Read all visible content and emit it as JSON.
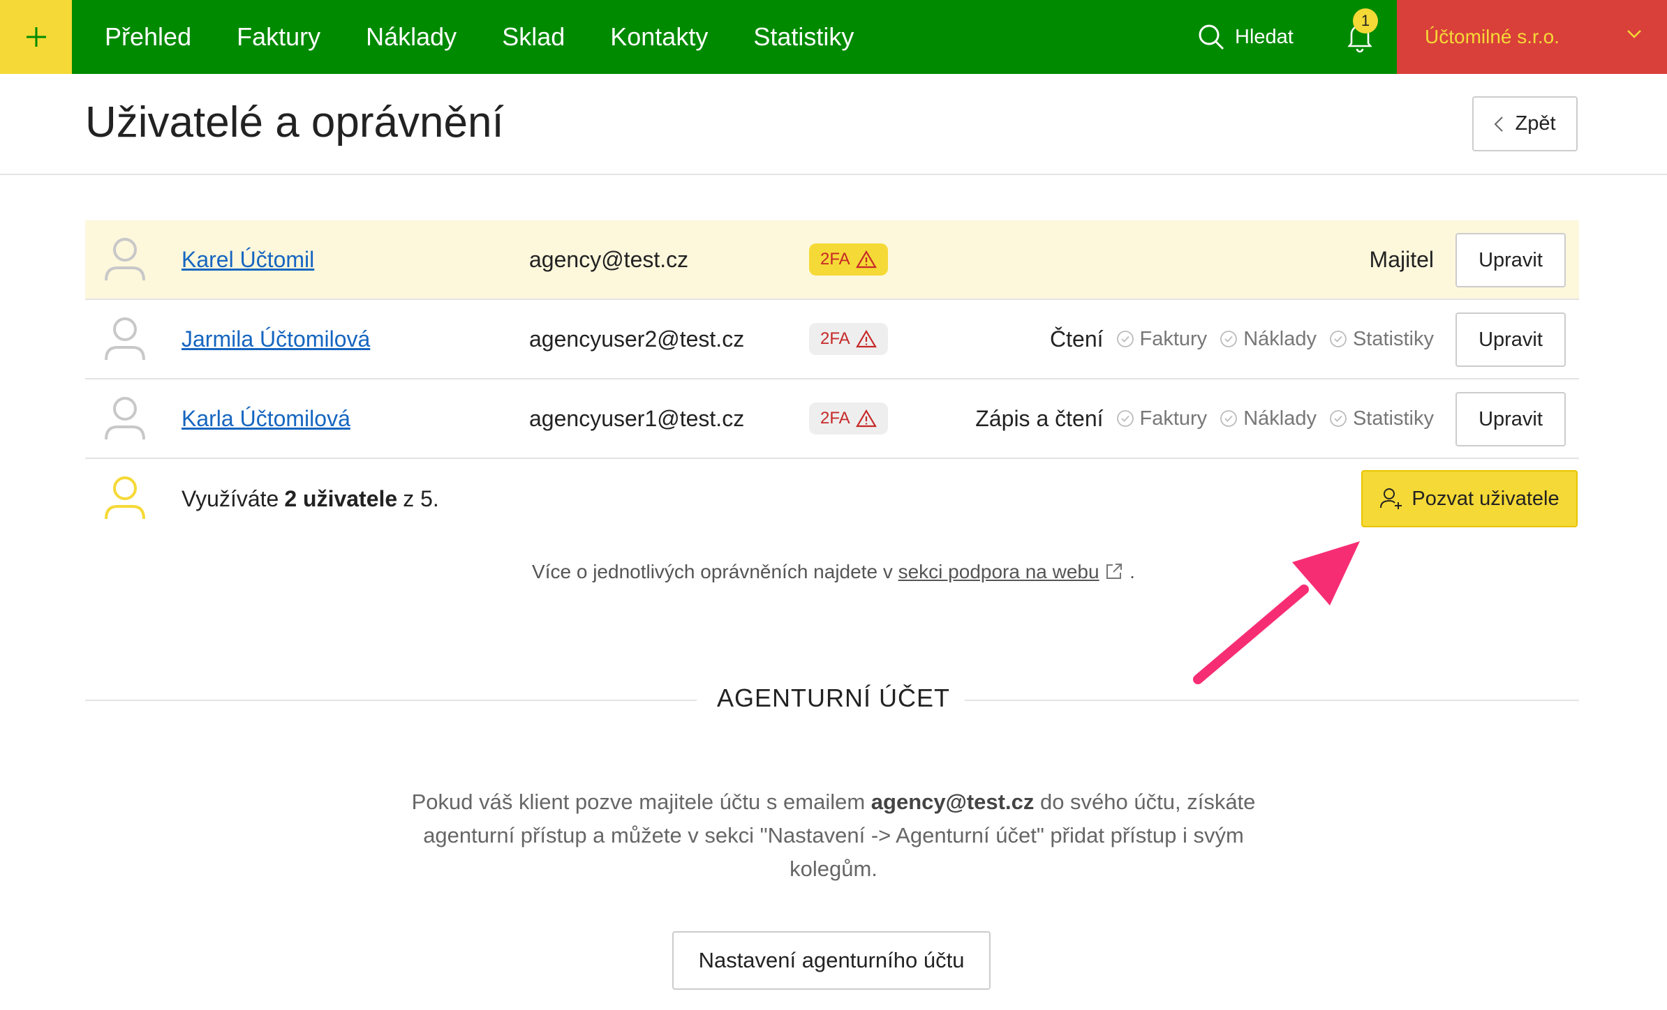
{
  "topbar": {
    "nav": [
      "Přehled",
      "Faktury",
      "Náklady",
      "Sklad",
      "Kontakty",
      "Statistiky"
    ],
    "search_label": "Hledat",
    "notification_count": "1",
    "company": "Účtomilné s.r.o.",
    "colors": {
      "bar": "#008A00",
      "accent": "#F5D936",
      "company": "#D9403A"
    }
  },
  "page": {
    "title": "Uživatelé a oprávnění",
    "back_label": "Zpět"
  },
  "users": [
    {
      "name": "Karel Účtomil",
      "email": "agency@test.cz",
      "tfa": "2FA",
      "role": "Majitel",
      "perms": [],
      "edit": "Upravit"
    },
    {
      "name": "Jarmila Účtomilová",
      "email": "agencyuser2@test.cz",
      "tfa": "2FA",
      "role": "Čtení",
      "perms": [
        "Faktury",
        "Náklady",
        "Statistiky"
      ],
      "edit": "Upravit"
    },
    {
      "name": "Karla Účtomilová",
      "email": "agencyuser1@test.cz",
      "tfa": "2FA",
      "role": "Zápis a čtení",
      "perms": [
        "Faktury",
        "Náklady",
        "Statistiky"
      ],
      "edit": "Upravit"
    }
  ],
  "summary": {
    "prefix": "Využíváte",
    "used": "2 uživatele",
    "suffix": "z 5.",
    "invite_label": "Pozvat uživatele"
  },
  "help": {
    "prefix": "Více o jednotlivých oprávněních najdete v",
    "link": "sekci podpora na webu",
    "suffix": "."
  },
  "agency": {
    "title": "AGENTURNÍ ÚČET",
    "text_1": "Pokud váš klient pozve majitele účtu s emailem",
    "email": "agency@test.cz",
    "text_2": "do svého účtu, získáte agenturní přístup a můžete v sekci \"Nastavení -> Agenturní účet\" přidat přístup i svým kolegům.",
    "button": "Nastavení agenturního účtu"
  }
}
